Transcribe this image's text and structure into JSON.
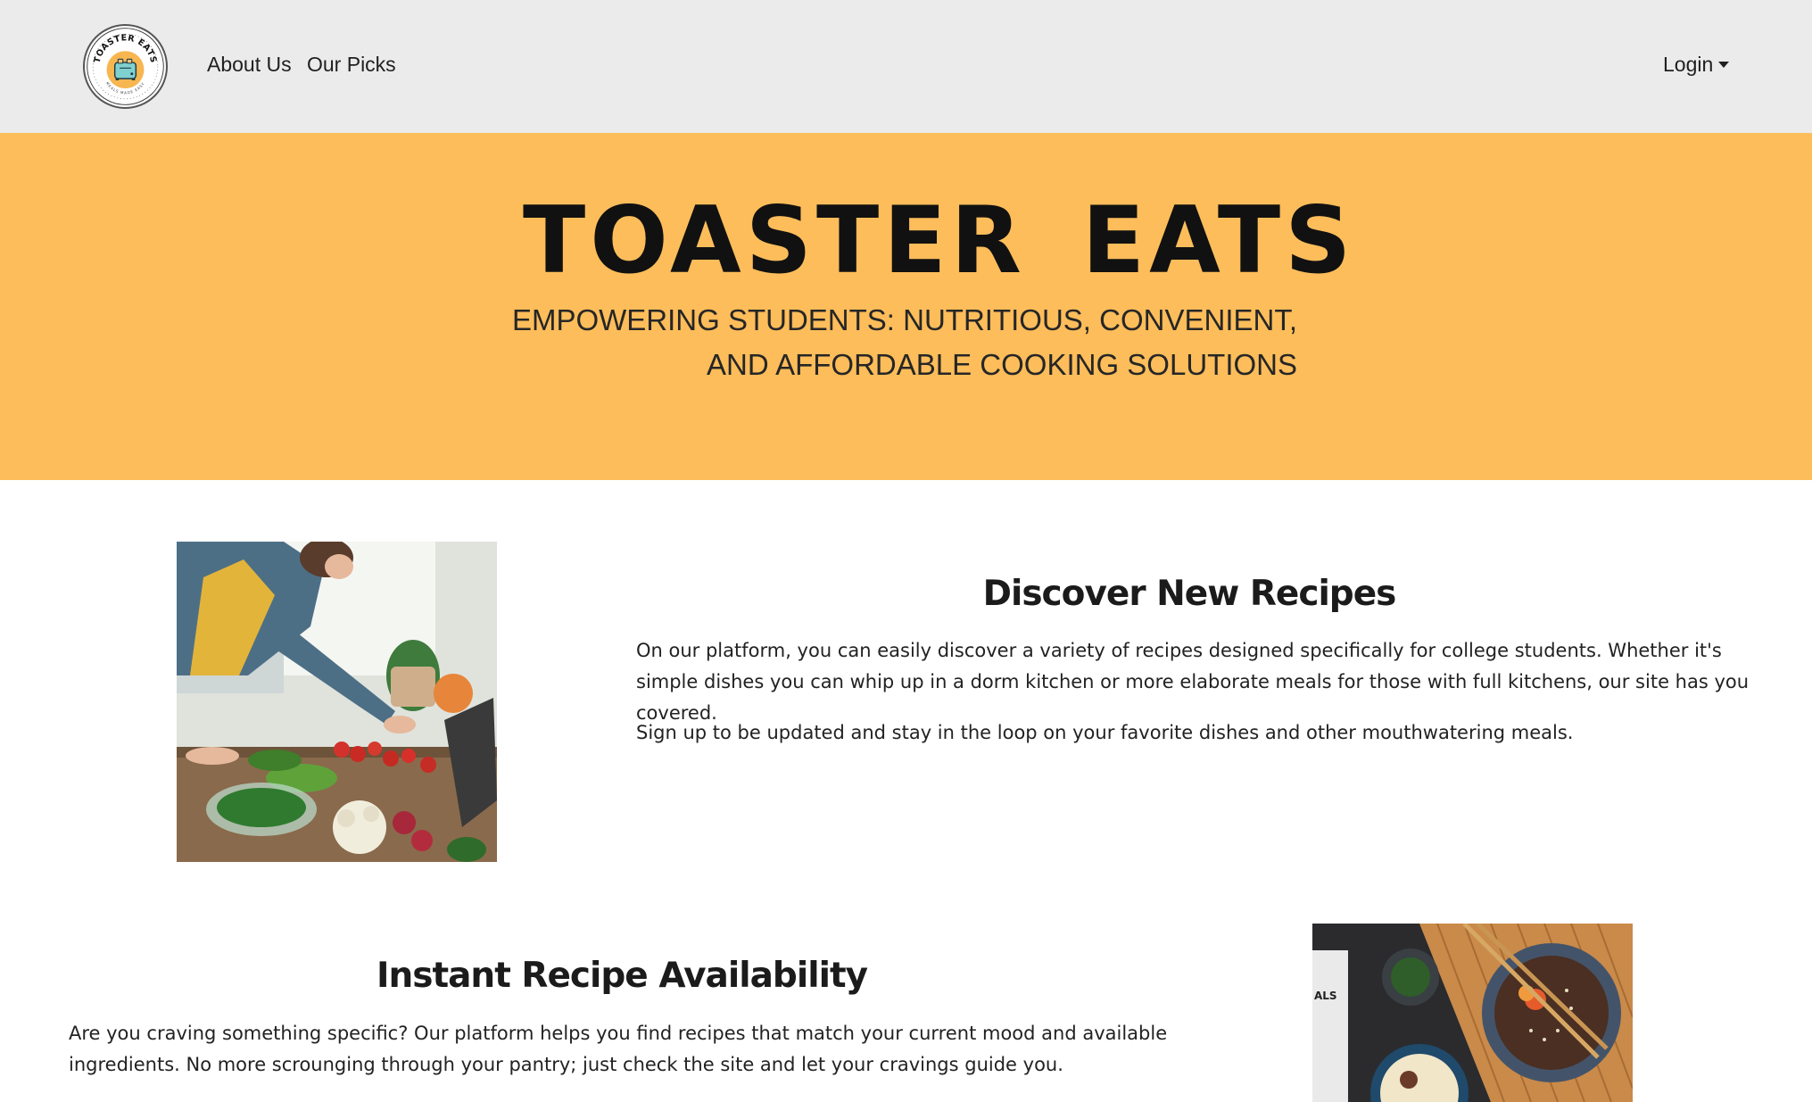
{
  "navbar": {
    "logo": {
      "top_text": "TOASTER EATS",
      "bottom_text": "MEALS MADE EASY",
      "icon": "toaster-icon"
    },
    "links": [
      {
        "label": "About Us"
      },
      {
        "label": "Our Picks"
      }
    ],
    "login_label": "Login"
  },
  "hero": {
    "title": "TOASTER  EATS",
    "subtitle_line1": "EMPOWERING STUDENTS: NUTRITIOUS, CONVENIENT,",
    "subtitle_line2": "AND AFFORDABLE COOKING SOLUTIONS",
    "background_color": "#fdbd5a"
  },
  "sections": [
    {
      "heading": "Discover New Recipes",
      "paragraphs": [
        "On our platform, you can easily discover a variety of recipes designed specifically for college students. Whether it's simple dishes you can whip up in a dorm kitchen or more elaborate meals for those with full kitchens, our site has you covered.",
        "Sign up to be updated and stay in the loop on your favorite dishes and other mouthwatering meals."
      ],
      "image": "person-preparing-vegetables-photo"
    },
    {
      "heading": "Instant Recipe Availability",
      "paragraphs": [
        "Are you craving something specific? Our platform helps you find recipes that match your current mood and available ingredients. No more scrounging through your pantry; just check the site and let your cravings guide you."
      ],
      "image": "noodle-bowls-photo",
      "image_label": "ALS"
    }
  ]
}
